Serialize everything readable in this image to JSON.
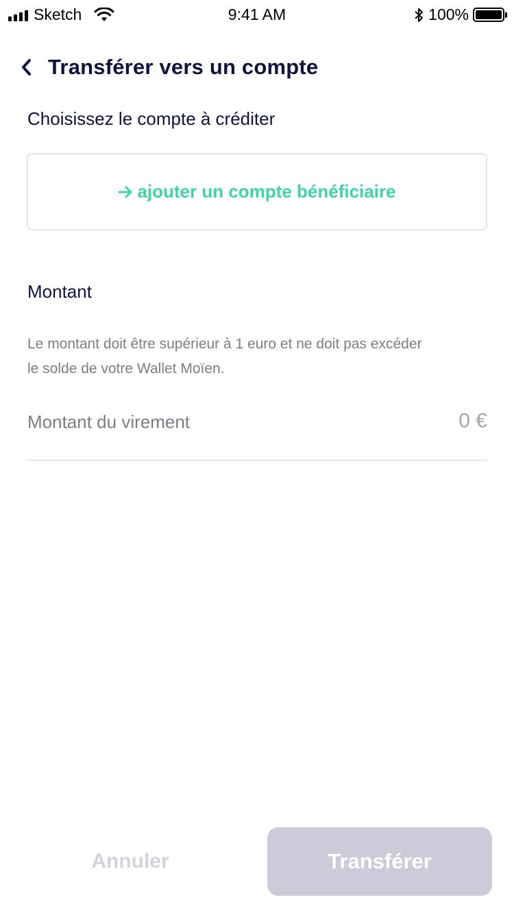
{
  "status_bar": {
    "carrier": "Sketch",
    "time": "9:41 AM",
    "battery_percent": "100%",
    "battery_level": 1.0,
    "icons": [
      "signal-icon",
      "wifi-icon",
      "bluetooth-icon",
      "battery-icon"
    ]
  },
  "header": {
    "title": "Transférer vers un compte",
    "back_icon": "chevron-left-icon"
  },
  "account_section": {
    "label": "Choisissez le compte à créditer",
    "add_account_label": "ajouter un compte bénéficiaire",
    "add_account_icon": "arrow-right-icon"
  },
  "amount_section": {
    "label": "Montant",
    "helper_line1": "Le montant doit être supérieur à 1 euro et ne doit pas excéder",
    "helper_line2": "le solde de votre Wallet Moïen.",
    "field_label": "Montant du virement",
    "field_placeholder": "0 €",
    "field_value": ""
  },
  "actions": {
    "cancel_label": "Annuler",
    "transfer_label": "Transférer",
    "transfer_enabled": false
  },
  "colors": {
    "primary_text": "#0d1440",
    "accent": "#3ed4a4",
    "muted_text": "#7b7d86",
    "disabled_button": "#cbcbd9",
    "border": "#e4e5ea"
  }
}
